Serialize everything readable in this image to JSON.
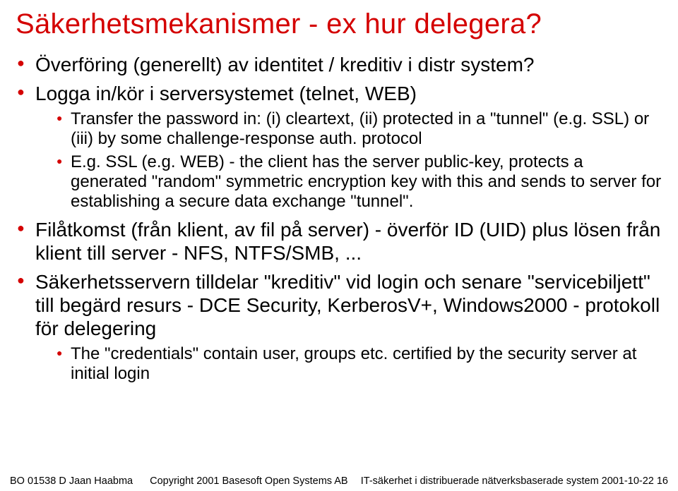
{
  "title": "Säkerhetsmekanismer - ex hur delegera?",
  "bullets": [
    {
      "text": "Överföring (generellt) av identitet / kreditiv i distr system?",
      "sub": []
    },
    {
      "text": "Logga in/kör i serversystemet (telnet, WEB)",
      "sub": [
        "Transfer the password in: (i) cleartext, (ii) protected in a \"tunnel\" (e.g. SSL) or (iii) by some challenge-response auth. protocol",
        "E.g. SSL (e.g. WEB) - the client has the server public-key, protects a generated \"random\" symmetric encryption key with this and sends to server for establishing a secure data exchange \"tunnel\"."
      ]
    },
    {
      "text": "Filåtkomst (från klient, av fil på server) - överför ID (UID) plus lösen från klient till server - NFS, NTFS/SMB, ...",
      "sub": []
    },
    {
      "text": "Säkerhetsservern tilldelar \"kreditiv\" vid login och senare \"servicebiljett\" till begärd resurs - DCE Security, KerberosV+, Windows2000 - protokoll för delegering",
      "sub": [
        "The \"credentials\" contain user, groups etc. certified by the security server at initial login"
      ]
    }
  ],
  "footer": {
    "left": "BO 01538 D   Jaan Haabma",
    "center": "Copyright 2001 Basesoft Open Systems AB",
    "right": "IT-säkerhet i distribuerade nätverksbaserade system    2001-10-22   16"
  }
}
